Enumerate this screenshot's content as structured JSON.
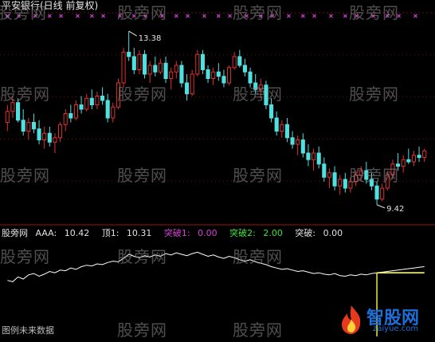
{
  "title": "平安银行(日线 前复权)",
  "watermark": "股旁网",
  "chart_data": [
    {
      "type": "candlestick",
      "title": "平安银行(日线 前复权)",
      "annotations": [
        {
          "label": "13.38",
          "kind": "high"
        },
        {
          "label": "9.42",
          "kind": "low"
        }
      ],
      "ylim": [
        9.0,
        13.8
      ],
      "up_color": "#e0312f",
      "down_color": "#4fe0e0",
      "signal_color": "#d640d6",
      "signal_marks_count": 30,
      "candles": [
        [
          11.3,
          11.7,
          11.1,
          11.55
        ],
        [
          11.55,
          11.9,
          11.4,
          11.75
        ],
        [
          11.75,
          11.85,
          11.3,
          11.35
        ],
        [
          11.35,
          11.6,
          11.0,
          11.1
        ],
        [
          11.1,
          11.4,
          10.9,
          11.3
        ],
        [
          11.3,
          11.5,
          11.05,
          11.15
        ],
        [
          11.15,
          11.35,
          10.8,
          10.9
        ],
        [
          10.9,
          11.2,
          10.7,
          11.05
        ],
        [
          11.05,
          11.2,
          10.75,
          10.85
        ],
        [
          10.85,
          11.05,
          10.6,
          10.95
        ],
        [
          10.95,
          11.3,
          10.85,
          11.25
        ],
        [
          11.25,
          11.6,
          11.1,
          11.5
        ],
        [
          11.5,
          11.7,
          11.3,
          11.4
        ],
        [
          11.4,
          11.8,
          11.35,
          11.7
        ],
        [
          11.7,
          11.9,
          11.5,
          11.6
        ],
        [
          11.6,
          11.95,
          11.55,
          11.85
        ],
        [
          11.85,
          12.05,
          11.6,
          11.7
        ],
        [
          11.7,
          12.0,
          11.6,
          11.9
        ],
        [
          11.9,
          12.1,
          11.7,
          11.8
        ],
        [
          11.8,
          11.95,
          11.3,
          11.4
        ],
        [
          11.4,
          11.75,
          11.3,
          11.65
        ],
        [
          11.65,
          12.3,
          11.6,
          12.2
        ],
        [
          12.2,
          13.0,
          12.1,
          12.9
        ],
        [
          12.9,
          13.38,
          12.7,
          12.8
        ],
        [
          12.8,
          13.0,
          12.4,
          12.5
        ],
        [
          12.5,
          12.95,
          12.4,
          12.85
        ],
        [
          12.85,
          12.95,
          12.3,
          12.4
        ],
        [
          12.4,
          12.7,
          12.2,
          12.6
        ],
        [
          12.6,
          12.8,
          12.35,
          12.45
        ],
        [
          12.45,
          12.75,
          12.4,
          12.65
        ],
        [
          12.65,
          12.8,
          12.2,
          12.3
        ],
        [
          12.3,
          12.55,
          12.05,
          12.45
        ],
        [
          12.45,
          12.7,
          12.3,
          12.6
        ],
        [
          12.6,
          12.7,
          12.1,
          12.2
        ],
        [
          12.2,
          12.4,
          11.8,
          11.95
        ],
        [
          11.95,
          12.5,
          11.9,
          12.4
        ],
        [
          12.4,
          12.95,
          12.35,
          12.85
        ],
        [
          12.85,
          12.95,
          12.4,
          12.5
        ],
        [
          12.5,
          12.6,
          12.2,
          12.3
        ],
        [
          12.3,
          12.55,
          12.15,
          12.45
        ],
        [
          12.45,
          12.65,
          12.25,
          12.35
        ],
        [
          12.35,
          12.5,
          12.1,
          12.2
        ],
        [
          12.2,
          12.6,
          12.15,
          12.55
        ],
        [
          12.55,
          12.9,
          12.5,
          12.8
        ],
        [
          12.8,
          12.95,
          12.55,
          12.6
        ],
        [
          12.6,
          12.75,
          12.35,
          12.45
        ],
        [
          12.45,
          12.55,
          12.1,
          12.2
        ],
        [
          12.2,
          12.4,
          11.95,
          12.05
        ],
        [
          12.05,
          12.3,
          11.85,
          12.15
        ],
        [
          12.15,
          12.25,
          11.6,
          11.7
        ],
        [
          11.7,
          11.85,
          11.3,
          11.4
        ],
        [
          11.4,
          11.55,
          11.0,
          11.1
        ],
        [
          11.1,
          11.35,
          10.95,
          11.25
        ],
        [
          11.25,
          11.4,
          10.85,
          10.95
        ],
        [
          10.95,
          11.1,
          10.7,
          10.8
        ],
        [
          10.8,
          11.0,
          10.55,
          10.9
        ],
        [
          10.9,
          11.05,
          10.5,
          10.6
        ],
        [
          10.6,
          10.8,
          10.3,
          10.45
        ],
        [
          10.45,
          10.7,
          10.2,
          10.6
        ],
        [
          10.6,
          10.75,
          10.25,
          10.35
        ],
        [
          10.35,
          10.5,
          9.95,
          10.05
        ],
        [
          10.05,
          10.25,
          9.8,
          10.15
        ],
        [
          10.15,
          10.3,
          9.75,
          9.85
        ],
        [
          9.85,
          10.1,
          9.65,
          10.0
        ],
        [
          10.0,
          10.15,
          9.7,
          9.8
        ],
        [
          9.8,
          10.05,
          9.7,
          9.95
        ],
        [
          9.95,
          10.2,
          9.85,
          10.1
        ],
        [
          10.1,
          10.3,
          9.95,
          10.2
        ],
        [
          10.2,
          10.4,
          9.9,
          10.0
        ],
        [
          10.0,
          10.15,
          9.75,
          9.85
        ],
        [
          9.85,
          9.95,
          9.42,
          9.55
        ],
        [
          9.55,
          9.9,
          9.5,
          9.8
        ],
        [
          9.8,
          10.2,
          9.75,
          10.1
        ],
        [
          10.1,
          10.45,
          10.0,
          10.35
        ],
        [
          10.35,
          10.6,
          10.2,
          10.3
        ],
        [
          10.3,
          10.55,
          10.15,
          10.45
        ],
        [
          10.45,
          10.7,
          10.35,
          10.4
        ],
        [
          10.4,
          10.65,
          10.3,
          10.55
        ],
        [
          10.55,
          10.75,
          10.4,
          10.5
        ],
        [
          10.5,
          10.7,
          10.4,
          10.65
        ]
      ]
    },
    {
      "type": "line",
      "series": [
        {
          "name": "AAA",
          "color": "#ffffff",
          "values": [
            10.2,
            10.18,
            10.25,
            10.22,
            10.28,
            10.3,
            10.26,
            10.29,
            10.33,
            10.31,
            10.35,
            10.34,
            10.38,
            10.36,
            10.4,
            10.42,
            10.41,
            10.44,
            10.43,
            10.46,
            10.48,
            10.47,
            10.52,
            10.58,
            10.55,
            10.53,
            10.56,
            10.54,
            10.57,
            10.55,
            10.59,
            10.57,
            10.6,
            10.58,
            10.56,
            10.59,
            10.61,
            10.58,
            10.55,
            10.57,
            10.54,
            10.52,
            10.55,
            10.53,
            10.5,
            10.48,
            10.5,
            10.47,
            10.45,
            10.43,
            10.4,
            10.38,
            10.36,
            10.37,
            10.35,
            10.33,
            10.34,
            10.32,
            10.3,
            10.31,
            10.29,
            10.28,
            10.3,
            10.27,
            10.26,
            10.28,
            10.27,
            10.29,
            10.28,
            10.3,
            10.31,
            10.32,
            10.33,
            10.34,
            10.35,
            10.36,
            10.37,
            10.38,
            10.39,
            10.4
          ]
        },
        {
          "name": "顶1",
          "color": "#ffff40",
          "values": [
            null,
            null,
            null,
            null,
            null,
            null,
            null,
            null,
            null,
            null,
            null,
            null,
            null,
            null,
            null,
            null,
            null,
            null,
            null,
            null,
            null,
            null,
            null,
            null,
            null,
            null,
            null,
            null,
            null,
            null,
            null,
            null,
            null,
            null,
            null,
            null,
            null,
            null,
            null,
            null,
            null,
            null,
            null,
            null,
            null,
            null,
            null,
            null,
            null,
            null,
            null,
            null,
            null,
            null,
            null,
            null,
            null,
            null,
            null,
            null,
            null,
            null,
            null,
            null,
            null,
            null,
            null,
            null,
            null,
            null,
            10.31,
            10.31,
            10.31,
            10.31,
            10.31,
            10.31,
            10.31,
            10.31,
            10.31,
            10.31
          ]
        }
      ],
      "ylim": [
        9.5,
        10.8
      ],
      "signal_line": {
        "label": "突破1",
        "from_index": 70,
        "color": "#ffff40"
      },
      "legend": {
        "source": "股旁网",
        "items": [
          {
            "label": "AAA:",
            "value": "10.42",
            "color": "#e0e0e0"
          },
          {
            "label": "顶1:",
            "value": "10.31",
            "color": "#e0e0e0"
          },
          {
            "label": "突破1:",
            "value": "0.00",
            "color": "#d640d6"
          },
          {
            "label": "突破2:",
            "value": "2.00",
            "color": "#40e040"
          },
          {
            "label": "突破:",
            "value": "0.00",
            "color": "#e0e0e0"
          }
        ]
      }
    }
  ],
  "colors": {
    "grid": "#6b1010",
    "axis_text": "#e0e0e0"
  },
  "footer": {
    "left_text": "图例未来数据"
  },
  "logo": {
    "text": "智股网",
    "url": "zaiyue.com"
  }
}
